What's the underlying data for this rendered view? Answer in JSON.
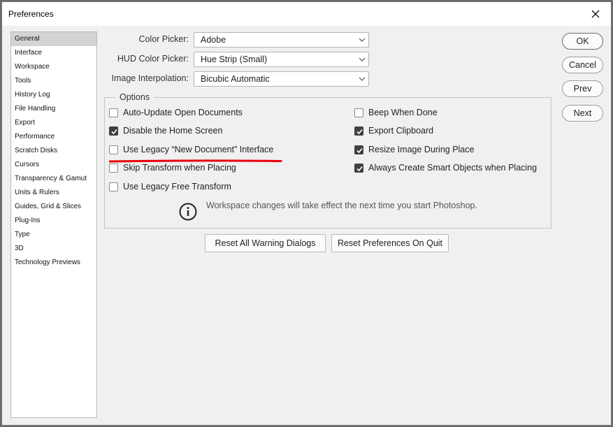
{
  "window": {
    "title": "Preferences"
  },
  "sidebar": {
    "items": [
      {
        "label": "General",
        "selected": true
      },
      {
        "label": "Interface"
      },
      {
        "label": "Workspace"
      },
      {
        "label": "Tools"
      },
      {
        "label": "History Log"
      },
      {
        "label": "File Handling"
      },
      {
        "label": "Export"
      },
      {
        "label": "Performance"
      },
      {
        "label": "Scratch Disks"
      },
      {
        "label": "Cursors"
      },
      {
        "label": "Transparency & Gamut"
      },
      {
        "label": "Units & Rulers"
      },
      {
        "label": "Guides, Grid & Slices"
      },
      {
        "label": "Plug-Ins"
      },
      {
        "label": "Type"
      },
      {
        "label": "3D"
      },
      {
        "label": "Technology Previews"
      }
    ]
  },
  "general": {
    "color_picker": {
      "label": "Color Picker:",
      "value": "Adobe"
    },
    "hud_color_picker": {
      "label": "HUD Color Picker:",
      "value": "Hue Strip (Small)"
    },
    "image_interpolation": {
      "label": "Image Interpolation:",
      "value": "Bicubic Automatic"
    }
  },
  "options": {
    "title": "Options",
    "left": [
      {
        "label": "Auto-Update Open Documents",
        "checked": false
      },
      {
        "label": "Disable the Home Screen",
        "checked": true
      },
      {
        "label": "Use Legacy “New Document” Interface",
        "checked": false
      },
      {
        "label": "Skip Transform when Placing",
        "checked": false
      },
      {
        "label": "Use Legacy Free Transform",
        "checked": false
      }
    ],
    "right": [
      {
        "label": "Beep When Done",
        "checked": false
      },
      {
        "label": "Export Clipboard",
        "checked": true
      },
      {
        "label": "Resize Image During Place",
        "checked": true
      },
      {
        "label": "Always Create Smart Objects when Placing",
        "checked": true
      }
    ],
    "info": "Workspace changes will take effect the next time you start Photoshop."
  },
  "buttons": {
    "reset_warnings": "Reset All Warning Dialogs",
    "reset_prefs": "Reset Preferences On Quit",
    "ok": "OK",
    "cancel": "Cancel",
    "prev": "Prev",
    "next": "Next"
  },
  "colors": {
    "highlight_underline": "#e8000b",
    "selected_item_bg": "#d4d4d4",
    "checkbox_checked": "#404040"
  },
  "icons": {
    "close": "close-icon",
    "info": "info-icon",
    "dropdown": "chevron-down-icon",
    "check": "check-icon"
  }
}
